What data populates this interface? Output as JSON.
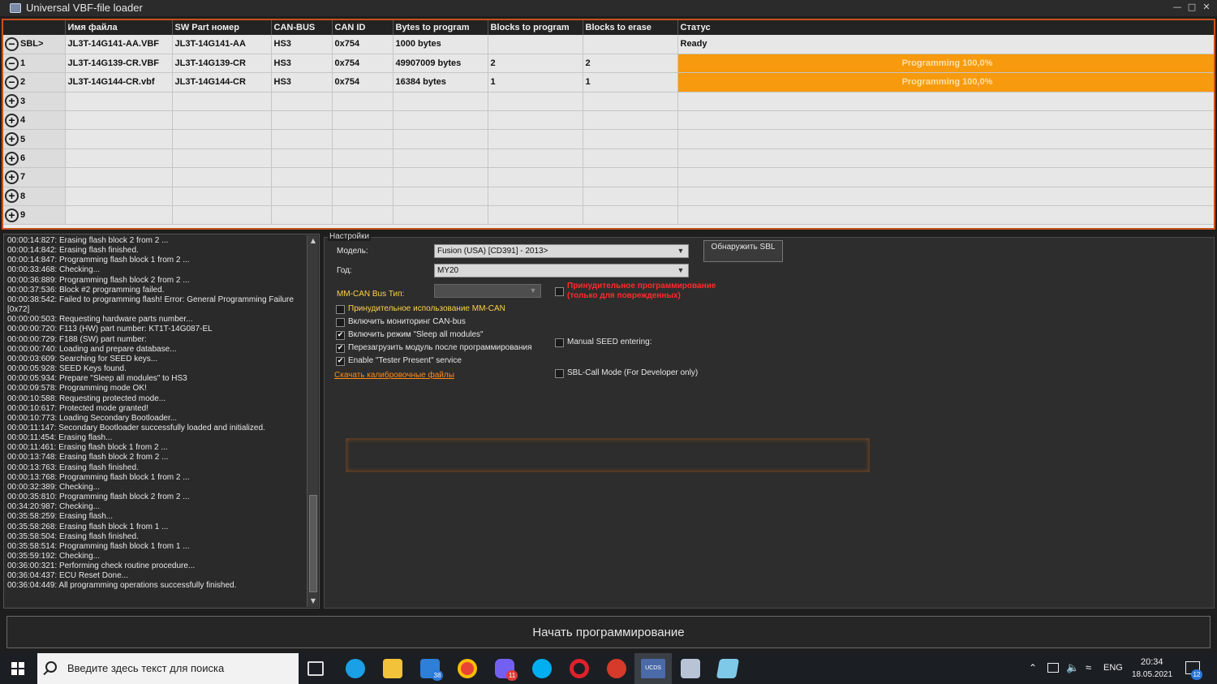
{
  "window": {
    "title": "Universal VBF-file loader"
  },
  "grid": {
    "columns": [
      "Имя файла",
      "SW Part номер",
      "CAN-BUS",
      "CAN ID",
      "Bytes to program",
      "Blocks to program",
      "Blocks to erase",
      "Статус"
    ],
    "rows": [
      {
        "label": "SBL>",
        "expand": "−",
        "file": "JL3T-14G141-AA.VBF",
        "part": "JL3T-14G141-AA",
        "bus": "HS3",
        "canid": "0x754",
        "bytes": "1000 bytes",
        "bprog": "",
        "berase": "",
        "status": "Ready",
        "progress": null
      },
      {
        "label": "1",
        "expand": "−",
        "file": "JL3T-14G139-CR.VBF",
        "part": "JL3T-14G139-CR",
        "bus": "HS3",
        "canid": "0x754",
        "bytes": "49907009 bytes",
        "bprog": "2",
        "berase": "2",
        "status": "Programming 100,0%",
        "progress": 1.0
      },
      {
        "label": "2",
        "expand": "−",
        "file": "JL3T-14G144-CR.vbf",
        "part": "JL3T-14G144-CR",
        "bus": "HS3",
        "canid": "0x754",
        "bytes": "16384 bytes",
        "bprog": "1",
        "berase": "1",
        "status": "Programming 100,0%",
        "progress": 1.0
      },
      {
        "label": "3",
        "expand": "+",
        "file": "",
        "part": "",
        "bus": "",
        "canid": "",
        "bytes": "",
        "bprog": "",
        "berase": "",
        "status": "",
        "progress": null
      },
      {
        "label": "4",
        "expand": "+",
        "file": "",
        "part": "",
        "bus": "",
        "canid": "",
        "bytes": "",
        "bprog": "",
        "berase": "",
        "status": "",
        "progress": null
      },
      {
        "label": "5",
        "expand": "+",
        "file": "",
        "part": "",
        "bus": "",
        "canid": "",
        "bytes": "",
        "bprog": "",
        "berase": "",
        "status": "",
        "progress": null
      },
      {
        "label": "6",
        "expand": "+",
        "file": "",
        "part": "",
        "bus": "",
        "canid": "",
        "bytes": "",
        "bprog": "",
        "berase": "",
        "status": "",
        "progress": null
      },
      {
        "label": "7",
        "expand": "+",
        "file": "",
        "part": "",
        "bus": "",
        "canid": "",
        "bytes": "",
        "bprog": "",
        "berase": "",
        "status": "",
        "progress": null
      },
      {
        "label": "8",
        "expand": "+",
        "file": "",
        "part": "",
        "bus": "",
        "canid": "",
        "bytes": "",
        "bprog": "",
        "berase": "",
        "status": "",
        "progress": null
      },
      {
        "label": "9",
        "expand": "+",
        "file": "",
        "part": "",
        "bus": "",
        "canid": "",
        "bytes": "",
        "bprog": "",
        "berase": "",
        "status": "",
        "progress": null
      }
    ]
  },
  "log": {
    "lines": [
      "00:00:14:827: Erasing flash block 2 from 2 ...",
      "00:00:14:842: Erasing flash finished.",
      "00:00:14:847: Programming flash block 1 from 2 ...",
      "00:00:33:468: Checking...",
      "00:00:36:889: Programming flash block 2 from 2 ...",
      "00:00:37:536: Block #2 programming failed.",
      "00:00:38:542: Failed to programming flash! Error: General Programming Failure [0x72]",
      "00:00:00:503: Requesting hardware parts number...",
      "00:00:00:720: F113 (HW) part number: KT1T-14G087-EL",
      "00:00:00:729: F188 (SW) part number:",
      "00:00:00:740: Loading and prepare database...",
      "00:00:03:609: Searching for SEED keys...",
      "00:00:05:928: SEED Keys found.",
      "00:00:05:934: Prepare \"Sleep all modules\" to HS3",
      "00:00:09:578: Programming mode OK!",
      "00:00:10:588: Requesting protected mode...",
      "00:00:10:617: Protected mode granted!",
      "00:00:10:773: Loading Secondary Bootloader...",
      "00:00:11:147: Secondary Bootloader successfully loaded and initialized.",
      "00:00:11:454: Erasing flash...",
      "00:00:11:461: Erasing flash block 1 from 2 ...",
      "00:00:13:748: Erasing flash block 2 from 2 ...",
      "00:00:13:763: Erasing flash finished.",
      "00:00:13:768: Programming flash block 1 from 2 ...",
      "00:00:32:389: Checking...",
      "00:00:35:810: Programming flash block 2 from 2 ...",
      "00:34:20:987: Checking...",
      "00:35:58:259: Erasing flash...",
      "00:35:58:268: Erasing flash block 1 from 1 ...",
      "00:35:58:504: Erasing flash finished.",
      "00:35:58:514: Programming flash block 1 from 1 ...",
      "00:35:59:192: Checking...",
      "00:36:00:321: Performing check routine procedure...",
      "00:36:04:437: ECU Reset Done...",
      "00:36:04:449: All programming operations successfully finished."
    ]
  },
  "settings": {
    "legend": "Настройки",
    "model_label": "Модель:",
    "model_value": "Fusion (USA) [CD391] - 2013>",
    "year_label": "Год:",
    "year_value": "MY20",
    "detect_sbl": "Обнаружить SBL",
    "mmcan_label": "MM-CAN Bus Тип:",
    "mmcan_value": "",
    "force_prog_label": "Принудительное программирование (только для поврежденных)",
    "options": [
      {
        "label": "Принудительное использование MM-CAN",
        "checked": false,
        "highlight": "#ffd24a"
      },
      {
        "label": "Включить мониторинг CAN-bus",
        "checked": false,
        "highlight": ""
      },
      {
        "label": "Включить режим \"Sleep all modules\"",
        "checked": true,
        "highlight": ""
      },
      {
        "label": "Перезагрузить модуль после программирования",
        "checked": true,
        "highlight": ""
      },
      {
        "label": "Enable \"Tester Present\" service",
        "checked": true,
        "highlight": ""
      }
    ],
    "download_link": "Скачать калибровочные файлы",
    "manual_seed_label": "Manual SEED entering:",
    "sbl_call_label": "SBL-Call Mode (For Developer only)"
  },
  "start_button": "Начать программирование",
  "taskbar": {
    "search_placeholder": "Введите здесь текст для поиска",
    "mail_badge": "38",
    "viber_badge": "11",
    "app_label": "UCDS",
    "lang": "ENG",
    "time": "20:34",
    "date": "18.05.2021",
    "notifications": "12"
  },
  "colors": {
    "progress": "#f79a0e",
    "accent_border": "#c9521a",
    "warning": "#ff2a2a",
    "link": "#ff8c1a"
  }
}
